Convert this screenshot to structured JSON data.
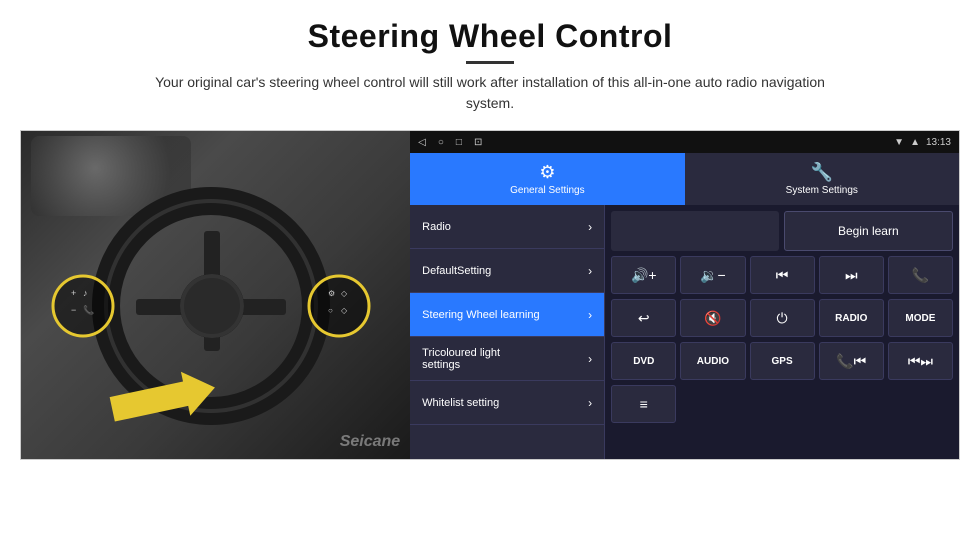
{
  "header": {
    "title": "Steering Wheel Control",
    "subtitle": "Your original car's steering wheel control will still work after installation of this all-in-one auto radio navigation system."
  },
  "status_bar": {
    "time": "13:13",
    "icons": [
      "◁",
      "○",
      "□",
      "⊡"
    ]
  },
  "tabs": [
    {
      "id": "general",
      "label": "General Settings",
      "icon": "⚙"
    },
    {
      "id": "system",
      "label": "System Settings",
      "icon": "🔧"
    }
  ],
  "menu_items": [
    {
      "label": "Radio",
      "active": false
    },
    {
      "label": "DefaultSetting",
      "active": false
    },
    {
      "label": "Steering Wheel learning",
      "active": true
    },
    {
      "label": "Tricoloured light settings",
      "active": false
    },
    {
      "label": "Whitelist setting",
      "active": false
    }
  ],
  "right_panel": {
    "begin_learn_label": "Begin learn",
    "buttons_row1": [
      {
        "label": "🔊+",
        "type": "icon"
      },
      {
        "label": "🔉−",
        "type": "icon"
      },
      {
        "label": "⏮",
        "type": "icon"
      },
      {
        "label": "⏭",
        "type": "icon"
      },
      {
        "label": "📞",
        "type": "icon"
      }
    ],
    "buttons_row2": [
      {
        "label": "↩",
        "type": "icon"
      },
      {
        "label": "🔇",
        "type": "icon"
      },
      {
        "label": "⏻",
        "type": "icon"
      },
      {
        "label": "RADIO",
        "type": "text"
      },
      {
        "label": "MODE",
        "type": "text"
      }
    ],
    "buttons_row3": [
      {
        "label": "DVD",
        "type": "text"
      },
      {
        "label": "AUDIO",
        "type": "text"
      },
      {
        "label": "GPS",
        "type": "text"
      },
      {
        "label": "📞⏮",
        "type": "icon"
      },
      {
        "label": "⏮⏭",
        "type": "icon"
      }
    ],
    "buttons_row4": [
      {
        "label": "≡",
        "type": "icon"
      }
    ]
  },
  "watermark": "Seicane"
}
